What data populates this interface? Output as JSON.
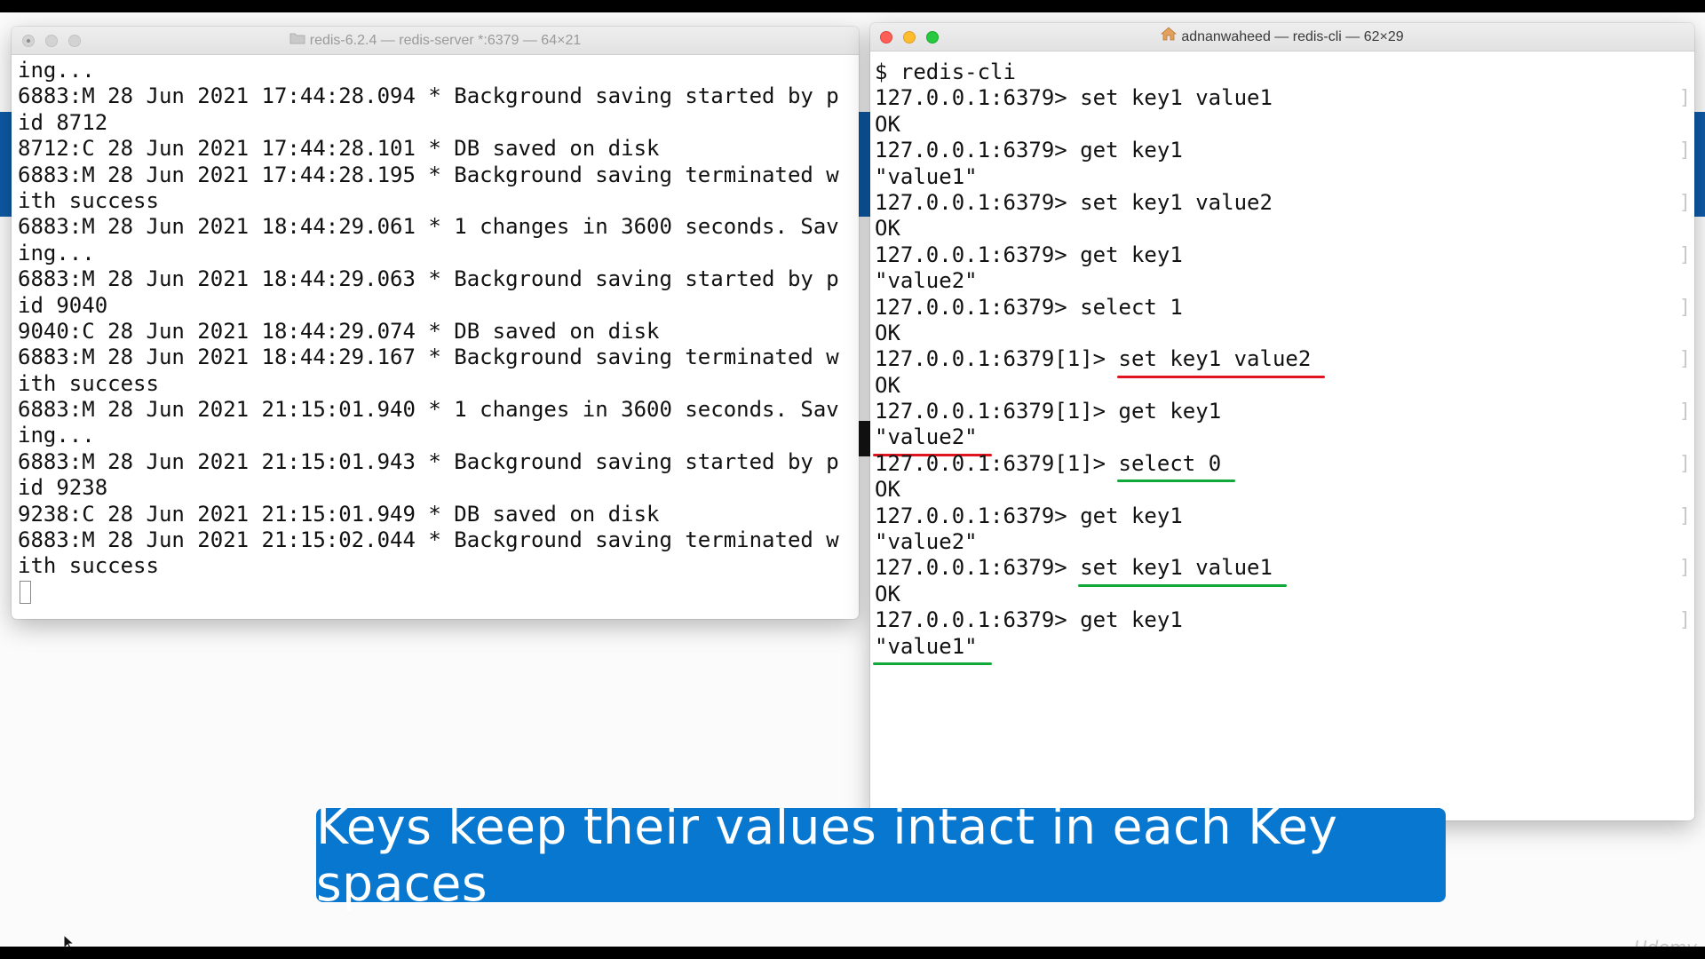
{
  "left_window": {
    "title": "redis-6.2.4 — redis-server *:6379 — 64×21",
    "lines": [
      "ing...",
      "6883:M 28 Jun 2021 17:44:28.094 * Background saving started by p",
      "id 8712",
      "8712:C 28 Jun 2021 17:44:28.101 * DB saved on disk",
      "6883:M 28 Jun 2021 17:44:28.195 * Background saving terminated w",
      "ith success",
      "6883:M 28 Jun 2021 18:44:29.061 * 1 changes in 3600 seconds. Sav",
      "ing...",
      "6883:M 28 Jun 2021 18:44:29.063 * Background saving started by p",
      "id 9040",
      "9040:C 28 Jun 2021 18:44:29.074 * DB saved on disk",
      "6883:M 28 Jun 2021 18:44:29.167 * Background saving terminated w",
      "ith success",
      "6883:M 28 Jun 2021 21:15:01.940 * 1 changes in 3600 seconds. Sav",
      "ing...",
      "6883:M 28 Jun 2021 21:15:01.943 * Background saving started by p",
      "id 9238",
      "9238:C 28 Jun 2021 21:15:01.949 * DB saved on disk",
      "6883:M 28 Jun 2021 21:15:02.044 * Background saving terminated w",
      "ith success"
    ]
  },
  "right_window": {
    "title": "adnanwaheed — redis-cli — 62×29",
    "lines": [
      {
        "prefix": "$ redis-cli",
        "cmd": "",
        "bracket": false
      },
      {
        "prefix": "127.0.0.1:6379> ",
        "cmd": "set key1 value1",
        "bracket": true
      },
      {
        "prefix": "OK",
        "cmd": "",
        "bracket": false
      },
      {
        "prefix": "127.0.0.1:6379> ",
        "cmd": "get key1",
        "bracket": true
      },
      {
        "prefix": "\"value1\"",
        "cmd": "",
        "bracket": false
      },
      {
        "prefix": "127.0.0.1:6379> ",
        "cmd": "set key1 value2",
        "bracket": true
      },
      {
        "prefix": "OK",
        "cmd": "",
        "bracket": false
      },
      {
        "prefix": "127.0.0.1:6379> ",
        "cmd": "get key1",
        "bracket": true
      },
      {
        "prefix": "\"value2\"",
        "cmd": "",
        "bracket": false
      },
      {
        "prefix": "127.0.0.1:6379> ",
        "cmd": "select 1",
        "bracket": true
      },
      {
        "prefix": "OK",
        "cmd": "",
        "bracket": false
      },
      {
        "prefix": "127.0.0.1:6379[1]> ",
        "cmd": "set key1 value2",
        "bracket": true,
        "highlight": "red",
        "target": "cmd"
      },
      {
        "prefix": "OK",
        "cmd": "",
        "bracket": false
      },
      {
        "prefix": "127.0.0.1:6379[1]> ",
        "cmd": "get key1",
        "bracket": true
      },
      {
        "prefix": "\"value2\"",
        "cmd": "",
        "bracket": false,
        "highlight": "red",
        "target": "prefix"
      },
      {
        "prefix": "127.0.0.1:6379[1]> ",
        "cmd": "select 0",
        "bracket": true,
        "highlight": "green",
        "target": "cmd"
      },
      {
        "prefix": "OK",
        "cmd": "",
        "bracket": false
      },
      {
        "prefix": "127.0.0.1:6379> ",
        "cmd": "get key1",
        "bracket": true
      },
      {
        "prefix": "\"value2\"",
        "cmd": "",
        "bracket": false
      },
      {
        "prefix": "127.0.0.1:6379> ",
        "cmd": "set key1 value1",
        "bracket": true,
        "highlight": "green",
        "target": "cmd"
      },
      {
        "prefix": "OK",
        "cmd": "",
        "bracket": false
      },
      {
        "prefix": "127.0.0.1:6379> ",
        "cmd": "get key1",
        "bracket": true
      },
      {
        "prefix": "\"value1\"",
        "cmd": "",
        "bracket": false,
        "highlight": "green",
        "target": "prefix"
      }
    ]
  },
  "caption": "Keys keep their values intact in each Key spaces",
  "watermark": "Udemy",
  "colors": {
    "caption_bg": "#0877d0",
    "underline_red": "#e0141e",
    "underline_green": "#11a83a"
  }
}
